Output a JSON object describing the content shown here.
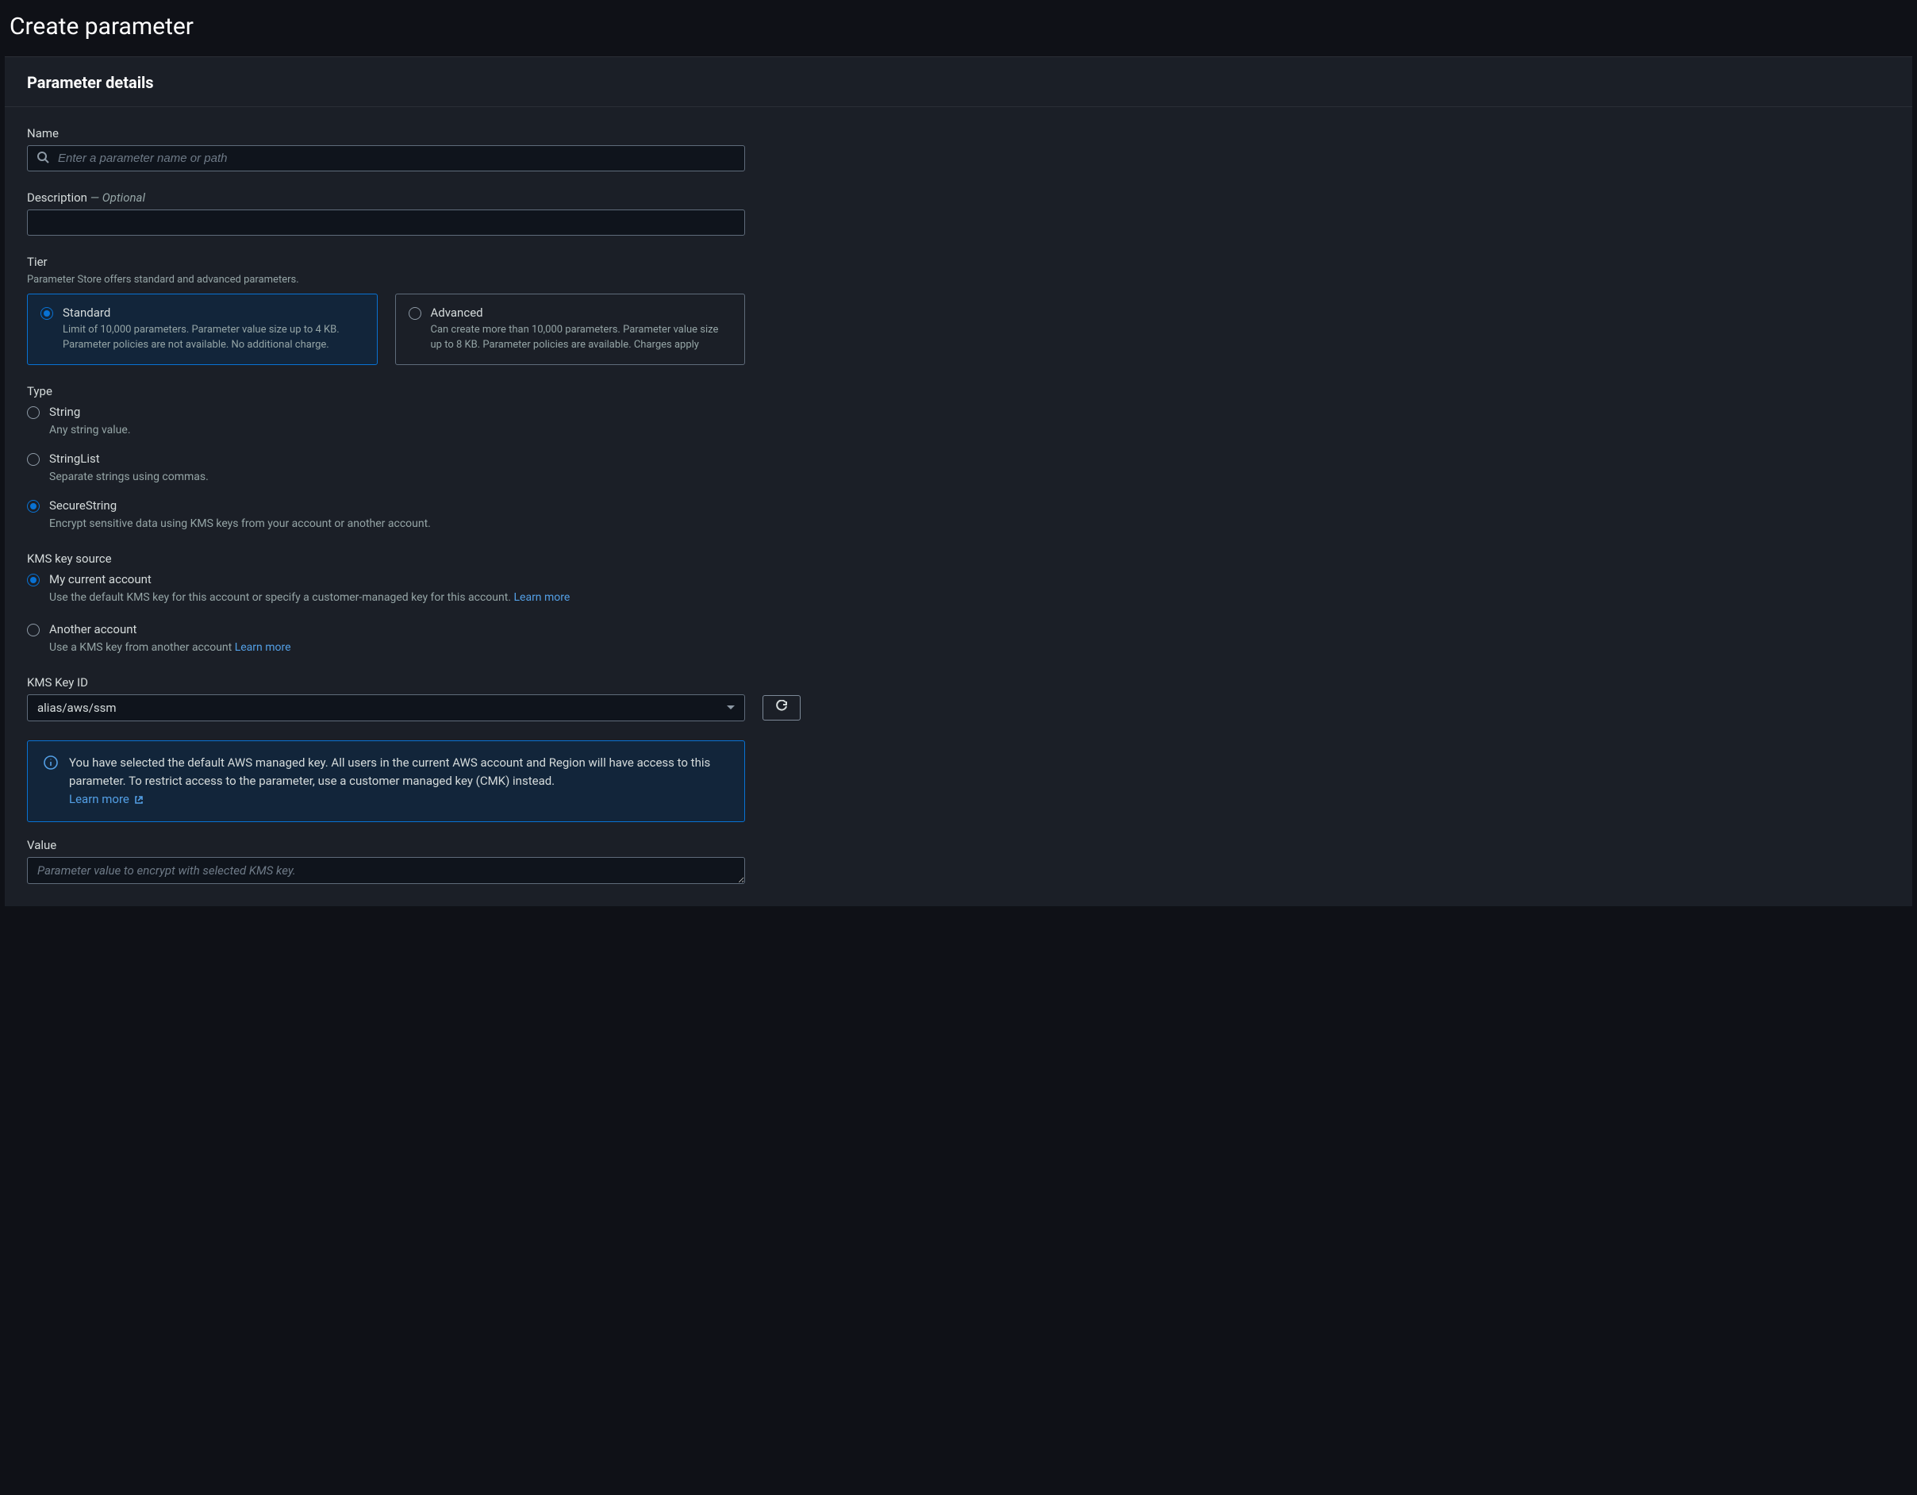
{
  "page": {
    "title": "Create parameter"
  },
  "panel": {
    "title": "Parameter details"
  },
  "name": {
    "label": "Name",
    "placeholder": "Enter a parameter name or path"
  },
  "description": {
    "label": "Description",
    "optional": " — Optional"
  },
  "tier": {
    "label": "Tier",
    "help": "Parameter Store offers standard and advanced parameters.",
    "standard": {
      "title": "Standard",
      "desc": "Limit of 10,000 parameters. Parameter value size up to 4 KB. Parameter policies are not available. No additional charge."
    },
    "advanced": {
      "title": "Advanced",
      "desc": "Can create more than 10,000 parameters. Parameter value size up to 8 KB. Parameter policies are available. Charges apply"
    }
  },
  "type": {
    "label": "Type",
    "string": {
      "title": "String",
      "desc": "Any string value."
    },
    "stringlist": {
      "title": "StringList",
      "desc": "Separate strings using commas."
    },
    "securestring": {
      "title": "SecureString",
      "desc": "Encrypt sensitive data using KMS keys from your account or another account."
    }
  },
  "kmsSource": {
    "label": "KMS key source",
    "current": {
      "title": "My current account",
      "desc": "Use the default KMS key for this account or specify a customer-managed key for this account. ",
      "link": "Learn more"
    },
    "another": {
      "title": "Another account",
      "desc": "Use a KMS key from another account ",
      "link": "Learn more"
    }
  },
  "kmsKeyId": {
    "label": "KMS Key ID",
    "value": "alias/aws/ssm"
  },
  "info": {
    "text": "You have selected the default AWS managed key. All users in the current AWS account and Region will have access to this parameter. To restrict access to the parameter, use a customer managed key (CMK) instead.",
    "link": "Learn more"
  },
  "value": {
    "label": "Value",
    "placeholder": "Parameter value to encrypt with selected KMS key."
  }
}
